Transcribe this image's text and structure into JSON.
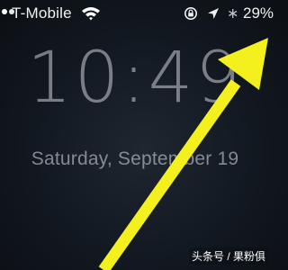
{
  "status_bar": {
    "carrier": "T-Mobile",
    "battery_text": "29%",
    "bluetooth_glyph": "∗",
    "icons": [
      "signal-dots-icon",
      "wifi-icon",
      "rotation-lock-icon",
      "location-arrow-icon",
      "bluetooth-icon"
    ]
  },
  "lock_screen": {
    "time": "10:49",
    "date": "Saturday, September 19"
  },
  "annotation": {
    "arrow_color": "#f4f01e",
    "icon": "pointer-arrow-icon"
  },
  "watermark": {
    "text": "头条号 / 果粉俱"
  }
}
